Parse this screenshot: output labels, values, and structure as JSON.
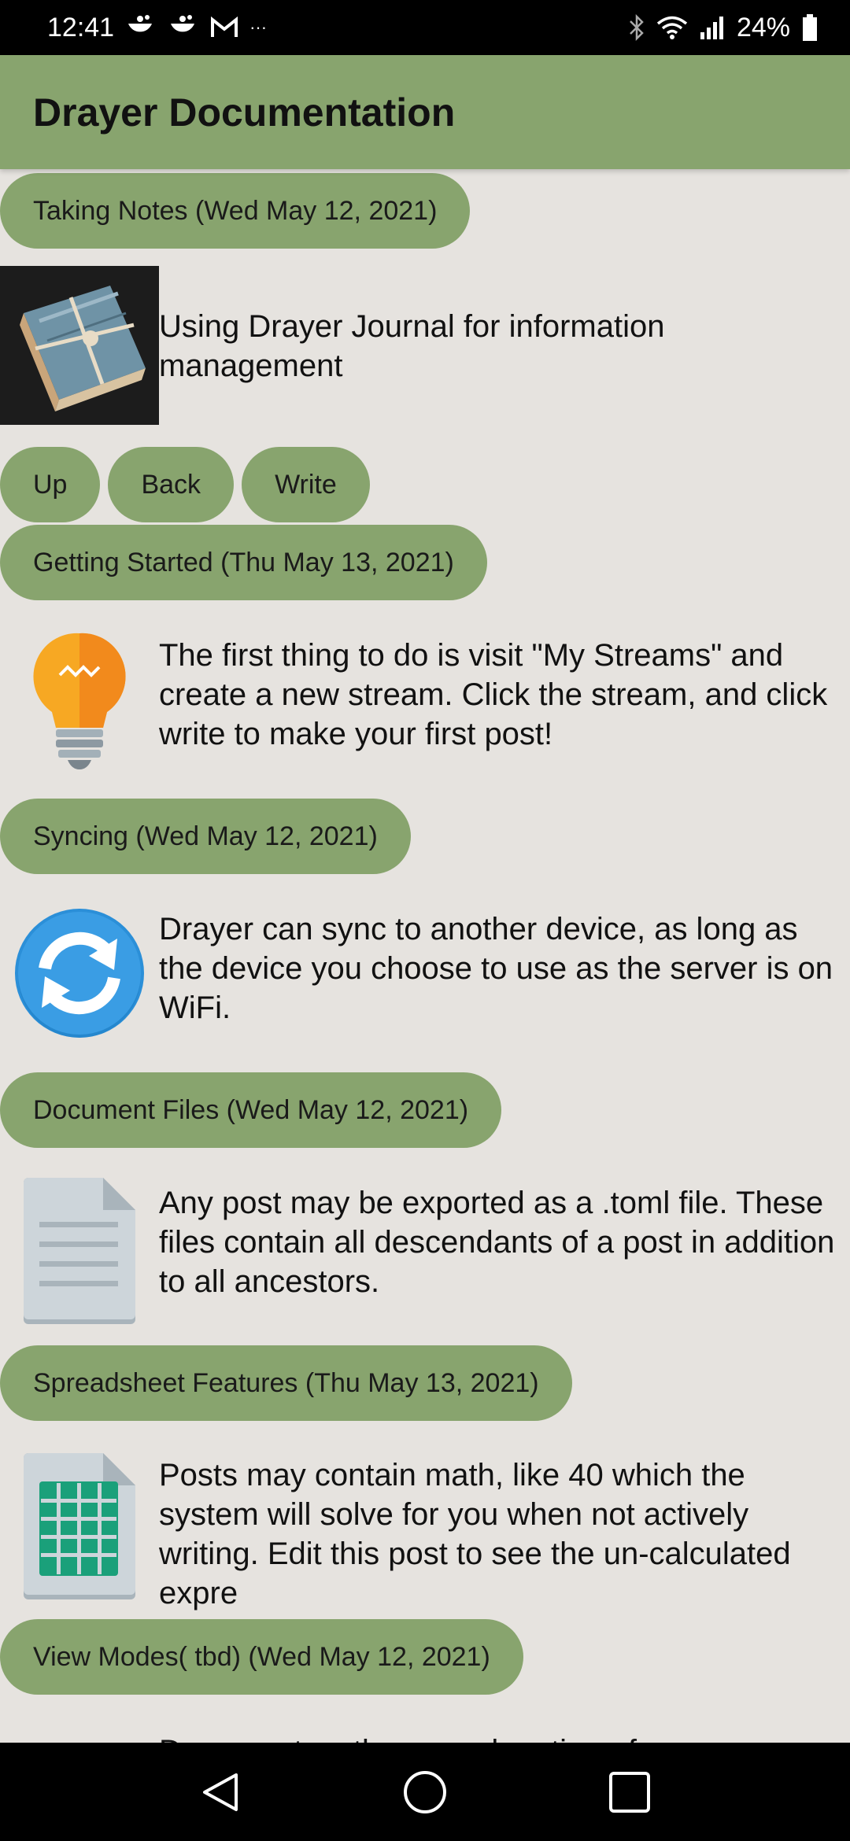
{
  "status_bar": {
    "time": "12:41",
    "battery": "24%",
    "overflow": "···"
  },
  "app_bar": {
    "title": "Drayer Documentation"
  },
  "header_entry": {
    "pill": "Taking Notes (Wed May 12, 2021)",
    "text": "Using Drayer Journal for information management",
    "icon": "journal-book-icon"
  },
  "buttons": {
    "up": "Up",
    "back": "Back",
    "write": "Write"
  },
  "entries": [
    {
      "pill": "Getting Started (Thu May 13, 2021)",
      "text": "The first thing to do is visit \"My Streams\" and create a new stream. Click the stream, and click write to make your first post!",
      "icon": "lightbulb-icon"
    },
    {
      "pill": "Syncing (Wed May 12, 2021)",
      "text": "Drayer can sync to another device, as long as the device you choose to use as the server is on WiFi.",
      "icon": "sync-icon"
    },
    {
      "pill": "Document Files (Wed May 12, 2021)",
      "text": "Any post may be exported as a .toml file. These files contain all descendants of a post in addition to all ancestors.",
      "icon": "document-icon"
    },
    {
      "pill": "Spreadsheet Features (Thu May 13, 2021)",
      "text": "Posts may contain math, like 40 which the system will solve for you when not actively writing. Edit this post to see the un-calculated expre",
      "icon": "spreadsheet-icon"
    },
    {
      "pill": "View Modes( tbd) (Wed May 12, 2021)",
      "text": "Documents... the ... explanation of ...",
      "icon": ""
    }
  ],
  "colors": {
    "accent": "#88a46e",
    "background": "#e6e3df"
  }
}
